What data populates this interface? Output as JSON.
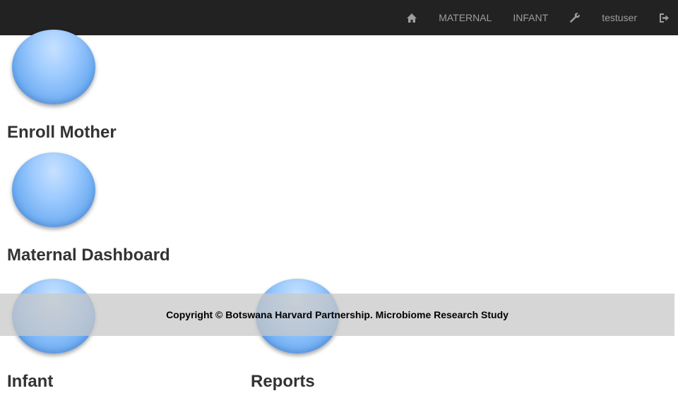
{
  "navbar": {
    "home_icon": "home-icon",
    "items": [
      {
        "label": "MATERNAL"
      },
      {
        "label": "INFANT"
      }
    ],
    "admin_icon": "wrench-icon",
    "username": "testuser",
    "logout_icon": "logout-icon"
  },
  "tiles": {
    "enroll_mother": "Enroll Mother",
    "maternal_dashboard": "Maternal Dashboard",
    "infant": "Infant",
    "reports": "Reports"
  },
  "footer": {
    "text": "Copyright © Botswana Harvard Partnership. Microbiome Research Study"
  },
  "colors": {
    "navbar_bg": "#222222",
    "nav_text": "#9d9d9d",
    "orb": "#6aaaf0",
    "footer_bg": "#d3d3d3"
  }
}
